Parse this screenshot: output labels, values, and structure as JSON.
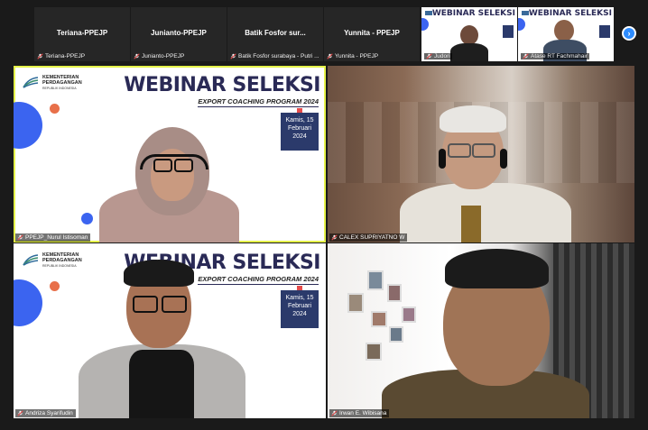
{
  "top_strip": {
    "participants": [
      {
        "center_name": "Teriana-PPEJP",
        "bottom_name": "Teriana-PPEJP"
      },
      {
        "center_name": "Junianto-PPEJP",
        "bottom_name": "Junianto-PPEJP"
      },
      {
        "center_name": "Batik Fosfor sur...",
        "bottom_name": "Batik Fosfor surabaya - Putri ..."
      },
      {
        "center_name": "Yunnita - PPEJP",
        "bottom_name": "Yunnita - PPEJP"
      }
    ],
    "video_thumbs": [
      {
        "title": "WEBINAR SELEKSI",
        "name": "Judori"
      },
      {
        "title": "WEBINAR SELEKSI",
        "name": "Atase RT Fachmahair"
      }
    ]
  },
  "slide": {
    "ministry_line1": "KEMENTERIAN",
    "ministry_line2": "PERDAGANGAN",
    "ministry_line3": "REPUBLIK INDONESIA",
    "title": "WEBINAR SELEKSI",
    "program": "EXPORT COACHING PROGRAM 2024",
    "date_line1": "Kamis, 15",
    "date_line2": "Februari",
    "date_line3": "2024"
  },
  "grid": [
    {
      "name": "PPEJP_Nurul Istisoman",
      "active": true
    },
    {
      "name": "CALEX SUPRIYATNO W"
    },
    {
      "name": "Andriza Syarifudin"
    },
    {
      "name": "Irwan E. Wibisana"
    }
  ],
  "colors": {
    "active_border": "#e5f24a",
    "slide_navy": "#2a2a56",
    "accent_blue": "#3b64f0",
    "accent_orange": "#e8704a",
    "muted_red": "#e54b4b",
    "next_button": "#2d8cff"
  },
  "icons": {
    "muted_mic": "mic-muted-icon",
    "next_page": "chevron-right-icon"
  }
}
